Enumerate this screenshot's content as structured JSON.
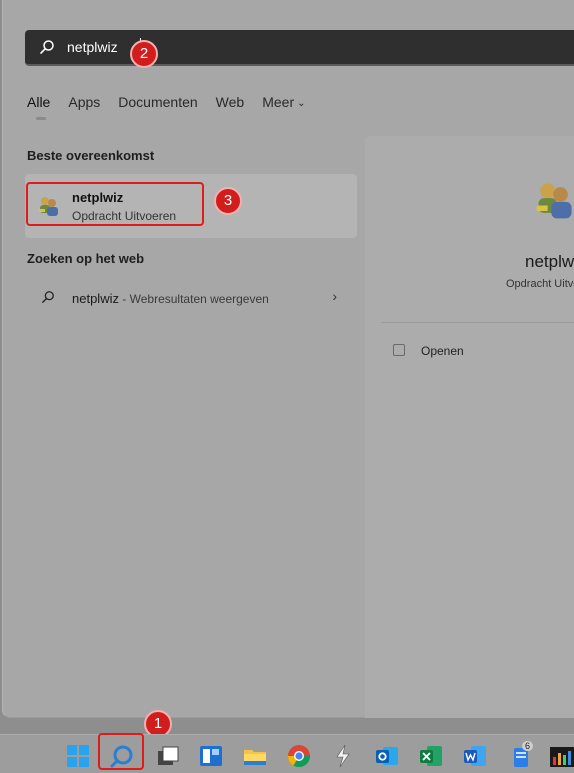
{
  "search": {
    "query": "netplwiz"
  },
  "tabs": [
    {
      "label": "Alle",
      "active": true
    },
    {
      "label": "Apps"
    },
    {
      "label": "Documenten"
    },
    {
      "label": "Web"
    },
    {
      "label": "Meer",
      "icon": "chevron-down-icon"
    }
  ],
  "best_match": {
    "heading": "Beste overeenkomst",
    "name": "netplwiz",
    "subtitle": "Opdracht Uitvoeren",
    "icon": "users-icon"
  },
  "web": {
    "heading": "Zoeken op het web",
    "query": "netplwiz",
    "suffix": " - Webresultaten weergeven"
  },
  "preview": {
    "name": "netplwiz",
    "subtitle": "Opdracht Uitvoeren",
    "action_label": "Openen"
  },
  "markers": {
    "one": "1",
    "two": "2",
    "three": "3"
  },
  "taskbar": {
    "badge_count": "6",
    "items": [
      "windows-start-icon",
      "search-icon",
      "task-view-icon",
      "widgets-icon",
      "file-explorer-icon",
      "chrome-icon",
      "app-s-icon",
      "outlook-icon",
      "excel-icon",
      "word-icon",
      "notepad-icon",
      "equalizer-app-icon"
    ]
  },
  "colors": {
    "highlight": "#e01b1b",
    "marker": "#d21d1d",
    "search_bar": "#2f2f2f"
  }
}
